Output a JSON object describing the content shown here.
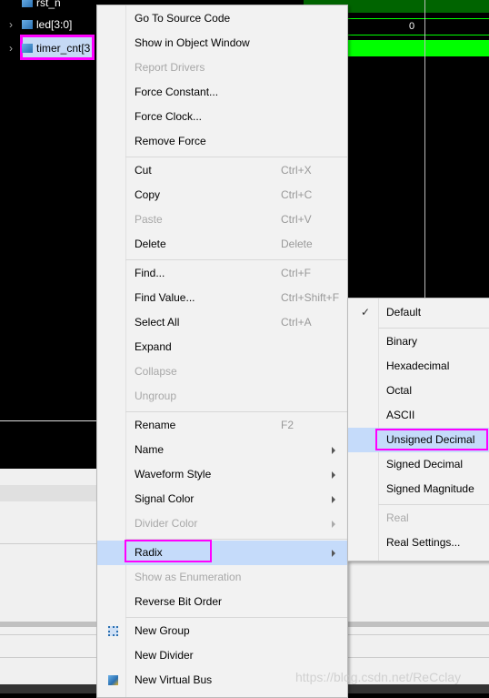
{
  "signals": [
    {
      "name": "rst_n",
      "icon": "input-port-icon"
    },
    {
      "name": "led[3:0]",
      "icon": "bus-icon"
    },
    {
      "name": "timer_cnt[3",
      "icon": "bus-icon"
    }
  ],
  "waveform": {
    "value_label": "0",
    "colors": {
      "bus": "#00ff00",
      "dark_green": "#006400"
    }
  },
  "context_menu": {
    "groups": [
      [
        {
          "label": "Go To Source Code"
        },
        {
          "label": "Show in Object Window"
        },
        {
          "label": "Report Drivers",
          "disabled": true
        },
        {
          "label": "Force Constant..."
        },
        {
          "label": "Force Clock..."
        },
        {
          "label": "Remove Force"
        }
      ],
      [
        {
          "label": "Cut",
          "shortcut": "Ctrl+X"
        },
        {
          "label": "Copy",
          "shortcut": "Ctrl+C"
        },
        {
          "label": "Paste",
          "shortcut": "Ctrl+V",
          "disabled": true
        },
        {
          "label": "Delete",
          "shortcut": "Delete"
        }
      ],
      [
        {
          "label": "Find...",
          "shortcut": "Ctrl+F"
        },
        {
          "label": "Find Value...",
          "shortcut": "Ctrl+Shift+F"
        },
        {
          "label": "Select All",
          "shortcut": "Ctrl+A"
        },
        {
          "label": "Expand"
        },
        {
          "label": "Collapse",
          "disabled": true
        },
        {
          "label": "Ungroup",
          "disabled": true
        }
      ],
      [
        {
          "label": "Rename",
          "shortcut": "F2"
        },
        {
          "label": "Name",
          "submenu": true
        },
        {
          "label": "Waveform Style",
          "submenu": true
        },
        {
          "label": "Signal Color",
          "submenu": true
        },
        {
          "label": "Divider Color",
          "submenu": true,
          "disabled": true
        }
      ],
      [
        {
          "label": "Radix",
          "submenu": true,
          "highlighted": true
        },
        {
          "label": "Show as Enumeration",
          "disabled": true
        },
        {
          "label": "Reverse Bit Order"
        }
      ],
      [
        {
          "label": "New Group",
          "icon": "group-icon"
        },
        {
          "label": "New Divider"
        },
        {
          "label": "New Virtual Bus",
          "icon": "virtual-bus-icon"
        }
      ]
    ]
  },
  "radix_submenu": {
    "groups": [
      [
        {
          "label": "Default",
          "checked": true
        }
      ],
      [
        {
          "label": "Binary"
        },
        {
          "label": "Hexadecimal"
        },
        {
          "label": "Octal"
        },
        {
          "label": "ASCII"
        },
        {
          "label": "Unsigned Decimal",
          "highlighted": true
        },
        {
          "label": "Signed Decimal"
        },
        {
          "label": "Signed Magnitude"
        }
      ],
      [
        {
          "label": "Real",
          "disabled": true
        },
        {
          "label": "Real Settings..."
        }
      ]
    ]
  },
  "highlight_color": "#ff00ff",
  "watermark": "https://blog.csdn.net/ReCclay"
}
